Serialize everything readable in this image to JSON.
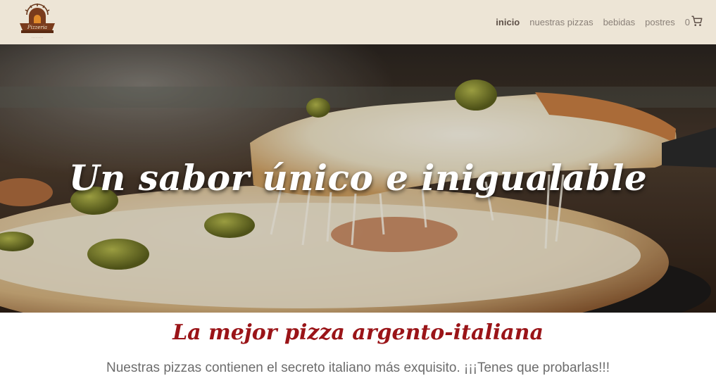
{
  "header": {
    "logo_icon": "pizzeria-logo",
    "nav": [
      {
        "label": "inicio",
        "active": true
      },
      {
        "label": "nuestras pizzas",
        "active": false
      },
      {
        "label": "bebidas",
        "active": false
      },
      {
        "label": "postres",
        "active": false
      }
    ],
    "cart": {
      "count": "0",
      "icon": "shopping-cart-icon"
    }
  },
  "hero": {
    "title": "Un sabor único e inigualable"
  },
  "main": {
    "tagline": "La mejor pizza argento-italiana",
    "subtitle": "Nuestras pizzas contienen el secreto italiano más exquisito. ¡¡¡Tenes que probarlas!!!"
  },
  "colors": {
    "header_bg": "#ede5d6",
    "accent_red": "#9a1418",
    "nav_text": "#8a8078"
  }
}
